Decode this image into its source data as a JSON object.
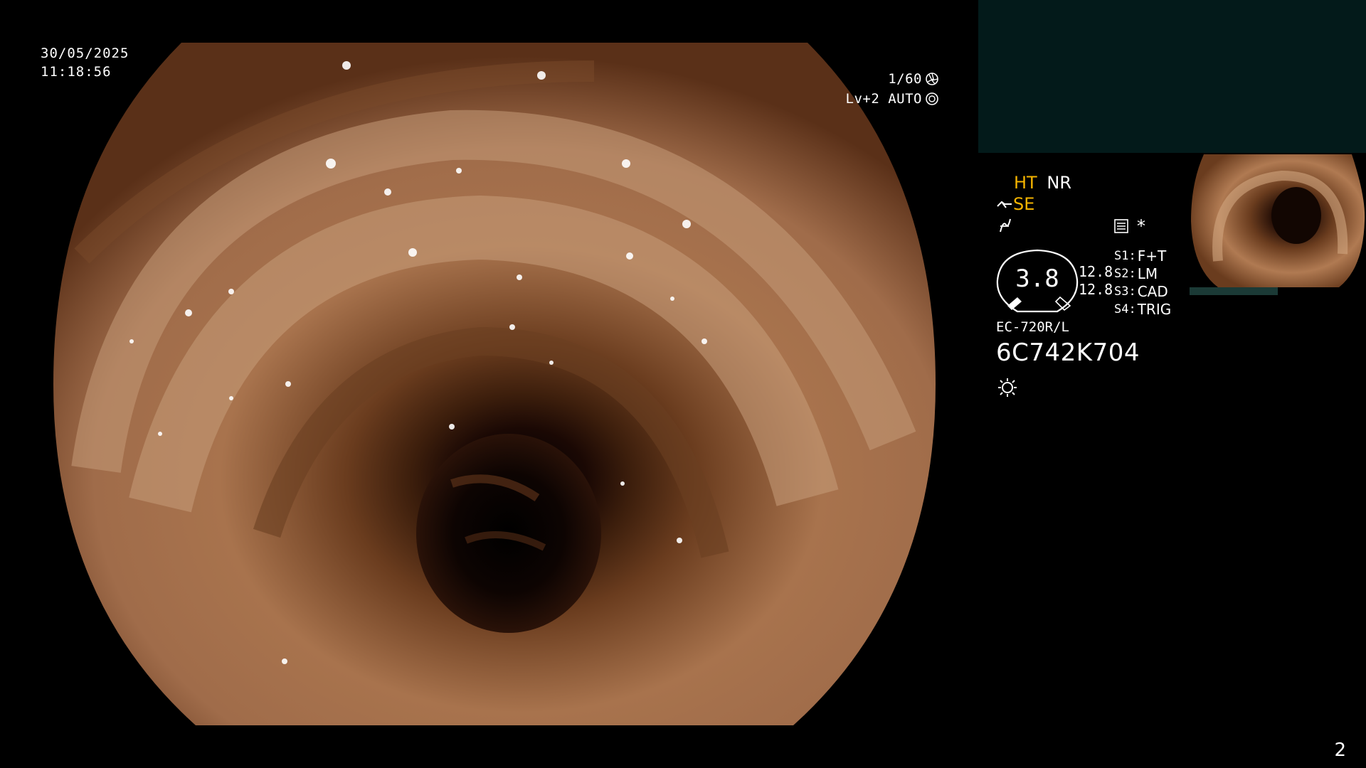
{
  "overlay": {
    "date": "30/05/2025",
    "time": "11:18:56",
    "shutter": "1/60",
    "level": "Lv+2 AUTO"
  },
  "panel": {
    "ht": "HT",
    "nr": "NR",
    "se": "SE",
    "zoom_value": "3.8",
    "scale_top": "12.8",
    "scale_bottom": "12.8",
    "modes": [
      {
        "key": "S1:",
        "value": "F+T"
      },
      {
        "key": "S2:",
        "value": "LM"
      },
      {
        "key": "S3:",
        "value": "CAD"
      },
      {
        "key": "S4:",
        "value": "TRIG"
      }
    ],
    "asterisk": "*",
    "scope_model": "EC-720R/L",
    "scope_serial": "6C742K704"
  },
  "page_number": "2",
  "colors": {
    "accent_yellow": "#f5b400",
    "teal_panel": "#031a1a",
    "thumb_bar": "#1b3a36"
  },
  "icons": [
    "shutter-icon",
    "auto-iris-icon",
    "contrast-icon",
    "color-enhance-icon",
    "record-icon",
    "light-icon"
  ]
}
